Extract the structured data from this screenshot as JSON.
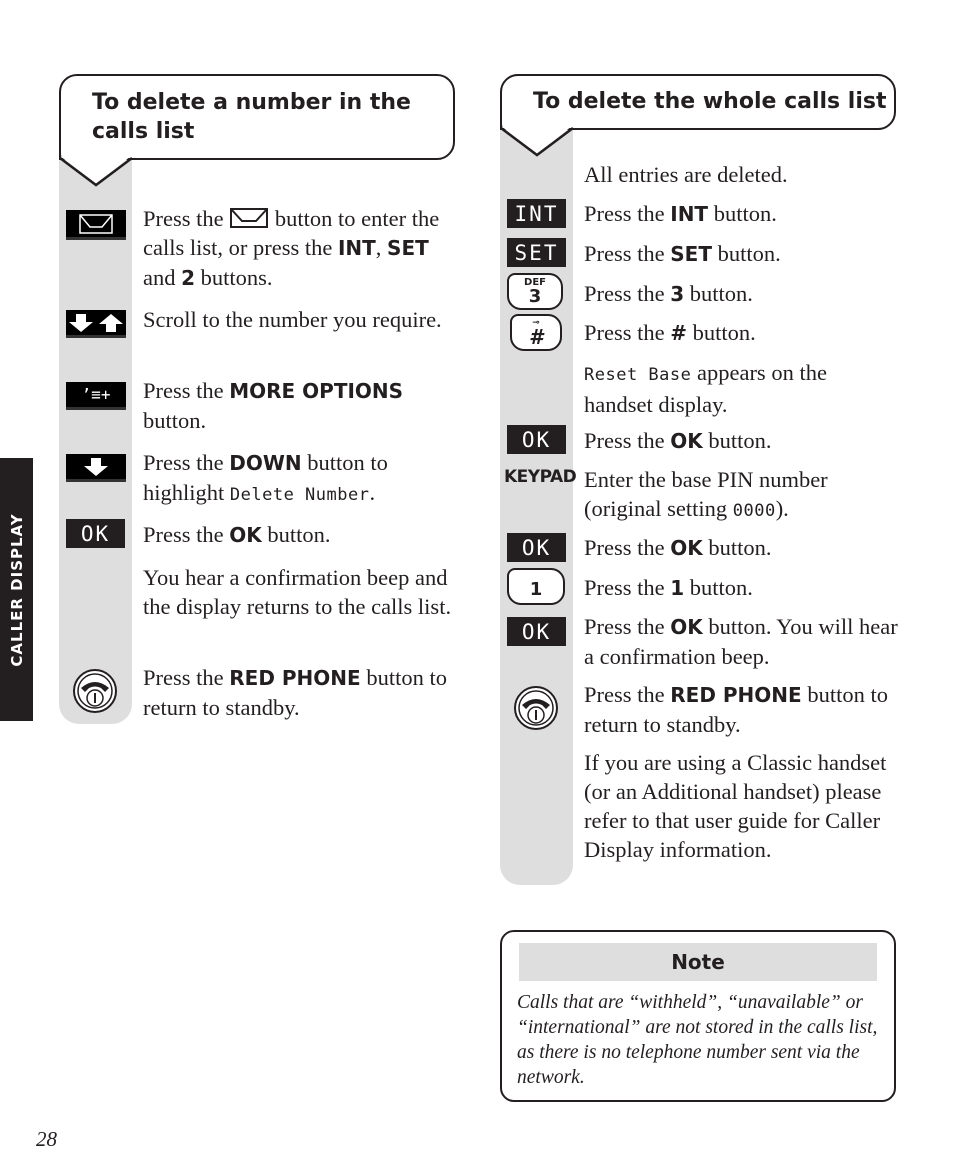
{
  "side_tab": {
    "label": "CALLER DISPLAY"
  },
  "page_number": "28",
  "left_section": {
    "title": "To delete a number in the calls list",
    "steps": [
      {
        "icon": "envelope-icon",
        "parts": [
          "Press the ",
          "[envelope]",
          " button to enter the calls list, or press the ",
          "INT",
          ", ",
          "SET",
          " and ",
          "2",
          " buttons."
        ]
      },
      {
        "icon": "down-up-arrows-icon",
        "text": "Scroll to the number you require."
      },
      {
        "icon": "more-options-icon",
        "icon_label": "’≡+",
        "pre": "Press the ",
        "bold": "MORE OPTIONS",
        "post": " button."
      },
      {
        "icon": "down-arrow-icon",
        "pre": "Press the ",
        "bold": "DOWN",
        "post": " button to highlight ",
        "lcd": "Delete Number",
        "end": "."
      },
      {
        "icon": "ok-key",
        "icon_label": "OK",
        "pre": "Press the ",
        "bold": "OK",
        "post": " button."
      },
      {
        "text": "You hear a confirmation beep and the display returns to the calls list."
      },
      {
        "icon": "red-phone-icon",
        "pre": "Press the ",
        "bold": "RED PHONE",
        "post": " button to return to standby."
      }
    ]
  },
  "right_section": {
    "title": "To delete the whole calls list",
    "steps": [
      {
        "text": "All entries are deleted."
      },
      {
        "icon_label": "INT",
        "pre": "Press the ",
        "bold": "INT",
        "post": " button."
      },
      {
        "icon_label": "SET",
        "pre": "Press the ",
        "bold": "SET",
        "post": " button."
      },
      {
        "icon_label": "3",
        "icon_sub": "DEF",
        "pre": "Press the ",
        "bold": "3",
        "post": " button."
      },
      {
        "icon_label": "#",
        "pre": "Press the ",
        "bold": "#",
        "post": " button."
      },
      {
        "lcd": "Reset Base",
        "post": " appears on the handset display."
      },
      {
        "icon_label": "OK",
        "pre": "Press the ",
        "bold": "OK",
        "post": " button."
      },
      {
        "icon_label": "KEYPAD",
        "pre": "Enter the base PIN number (original setting ",
        "lcd": "0000",
        "post": ")."
      },
      {
        "icon_label": "OK",
        "pre": "Press the ",
        "bold": "OK",
        "post": " button."
      },
      {
        "icon_label": "1",
        "pre": "Press the ",
        "bold": "1",
        "post": " button."
      },
      {
        "icon_label": "OK",
        "pre": "Press the ",
        "bold": "OK",
        "post": " button. You will hear a confirmation beep."
      },
      {
        "icon": "red-phone-icon",
        "pre": "Press the ",
        "bold": "RED PHONE",
        "post": " button to return to standby."
      },
      {
        "text": "If you are using a Classic handset (or an Additional handset) please refer to that user guide for Caller Display information."
      }
    ]
  },
  "note": {
    "title": "Note",
    "body": "Calls that are “withheld”, “unavailable” or “international” are not stored in the calls list, as there is no telephone number sent via the network."
  }
}
